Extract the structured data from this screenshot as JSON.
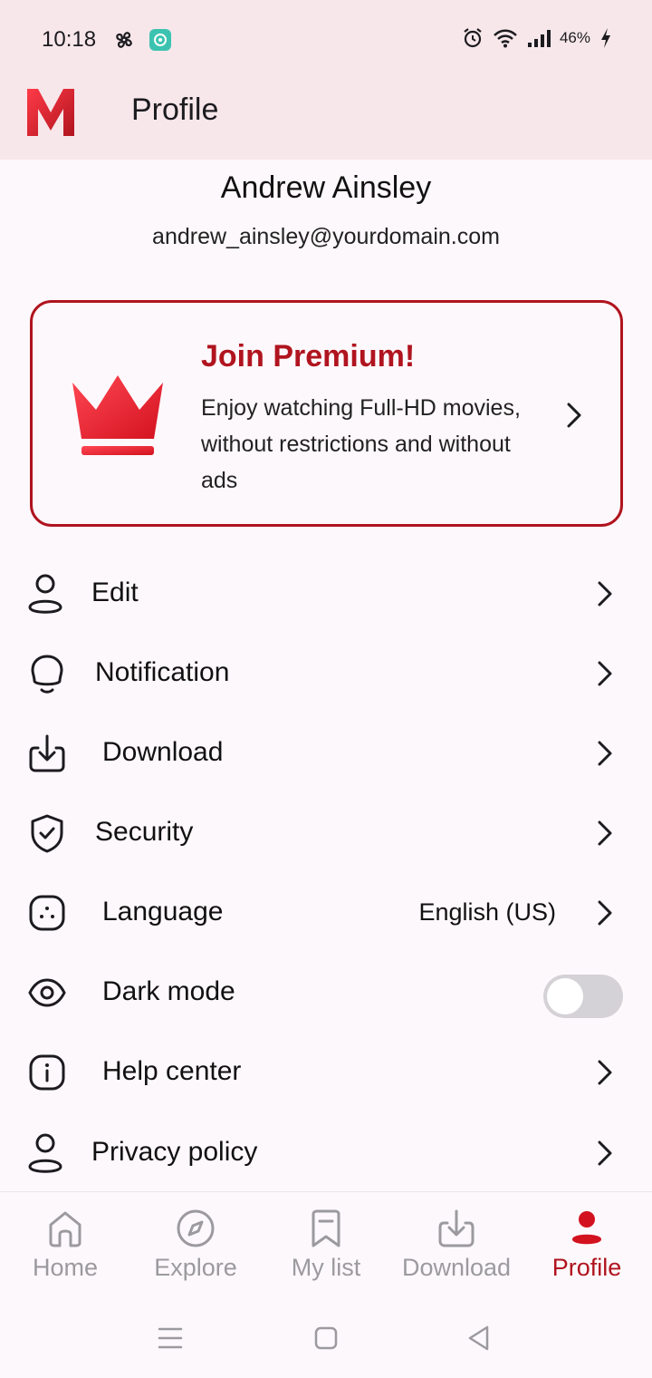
{
  "status": {
    "time": "10:18",
    "battery": "46%"
  },
  "app_bar": {
    "title": "Profile",
    "logo_letter": "M"
  },
  "user": {
    "name": "Andrew Ainsley",
    "email": "andrew_ainsley@yourdomain.com"
  },
  "premium": {
    "title": "Join Premium!",
    "description": "Enjoy watching Full-HD movies, without restrictions and without ads"
  },
  "menu": [
    {
      "label": "Edit",
      "icon": "user-icon"
    },
    {
      "label": "Notification",
      "icon": "bell-icon"
    },
    {
      "label": "Download",
      "icon": "download-icon"
    },
    {
      "label": "Security",
      "icon": "shield-icon"
    },
    {
      "label": "Language",
      "icon": "language-icon",
      "value": "English (US)"
    },
    {
      "label": "Dark mode",
      "icon": "eye-icon",
      "toggle": false
    },
    {
      "label": "Help center",
      "icon": "info-icon"
    },
    {
      "label": "Privacy policy",
      "icon": "user-icon"
    }
  ],
  "bottom_nav": [
    {
      "label": "Home",
      "icon": "home-icon"
    },
    {
      "label": "Explore",
      "icon": "compass-icon"
    },
    {
      "label": "My list",
      "icon": "bookmark-icon"
    },
    {
      "label": "Download",
      "icon": "download-icon"
    },
    {
      "label": "Profile",
      "icon": "profile-icon",
      "active": true
    }
  ],
  "colors": {
    "accent": "#b0141f",
    "header_bg": "#f7e7ea",
    "inactive": "#9b9a9e"
  }
}
